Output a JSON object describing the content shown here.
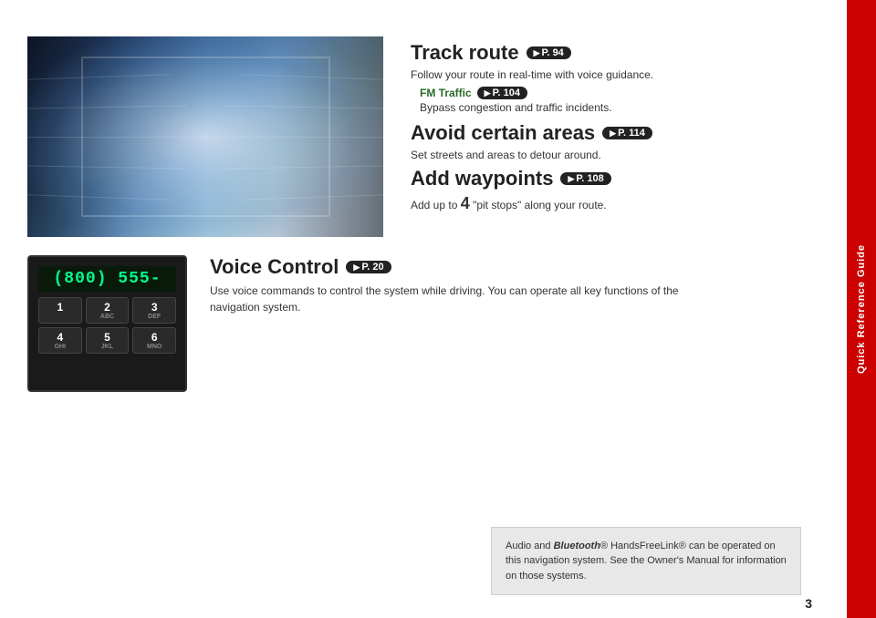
{
  "sidebar": {
    "label": "Quick Reference Guide"
  },
  "top_right": {
    "track_route": {
      "heading": "Track route",
      "page_ref": "P. 94",
      "description": "Follow your route in real-time with voice guidance.",
      "fm_traffic": {
        "label": "FM Traffic",
        "page_ref": "P. 104"
      },
      "bypass_text": "Bypass congestion and traffic incidents."
    },
    "avoid_areas": {
      "heading": "Avoid certain areas",
      "page_ref": "P. 114",
      "description": "Set streets and areas to detour around."
    },
    "add_waypoints": {
      "heading": "Add waypoints",
      "page_ref": "P. 108",
      "description_prefix": "Add up to ",
      "number": "4",
      "description_suffix": " \"pit stops\" along your route."
    }
  },
  "voice_control": {
    "heading": "Voice Control",
    "page_ref": "P. 20",
    "description": "Use voice commands to control the system while driving. You can operate all key functions of the navigation system."
  },
  "phone": {
    "display": "(800) 555-",
    "keys": [
      {
        "label": "1",
        "sub": ""
      },
      {
        "label": "2",
        "sub": "ABC"
      },
      {
        "label": "3",
        "sub": "DEF"
      },
      {
        "label": "4",
        "sub": "GHI"
      },
      {
        "label": "5",
        "sub": "JKL"
      },
      {
        "label": "6",
        "sub": "MNO"
      }
    ]
  },
  "bottom_note": {
    "text_start": "Audio and ",
    "bluetooth": "Bluetooth",
    "text_middle": "® HandsFreeLink® can be operated on this navigation system. See the Owner's Manual for information on those systems."
  },
  "page_number": "3"
}
